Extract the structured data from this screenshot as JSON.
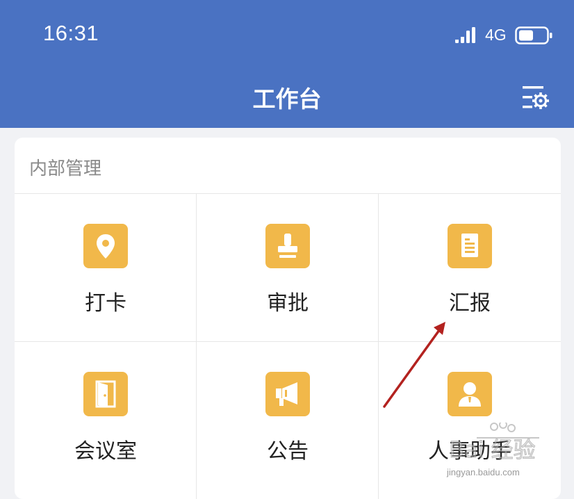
{
  "status_bar": {
    "time": "16:31",
    "network": "4G",
    "icons": [
      "signal-icon",
      "battery-icon"
    ]
  },
  "header": {
    "title": "工作台",
    "settings_icon": "list-settings-icon"
  },
  "section": {
    "title": "内部管理",
    "items": [
      {
        "label": "打卡",
        "icon": "location-pin-icon"
      },
      {
        "label": "审批",
        "icon": "stamp-icon"
      },
      {
        "label": "汇报",
        "icon": "document-icon"
      },
      {
        "label": "会议室",
        "icon": "door-icon"
      },
      {
        "label": "公告",
        "icon": "megaphone-icon"
      },
      {
        "label": "人事助手",
        "icon": "person-icon"
      }
    ]
  },
  "colors": {
    "header_bg": "#4a72c2",
    "tile_bg": "#f1b84a",
    "annotation_arrow": "#b3221f"
  },
  "watermark": {
    "text": "jingyan.baidu.com"
  }
}
